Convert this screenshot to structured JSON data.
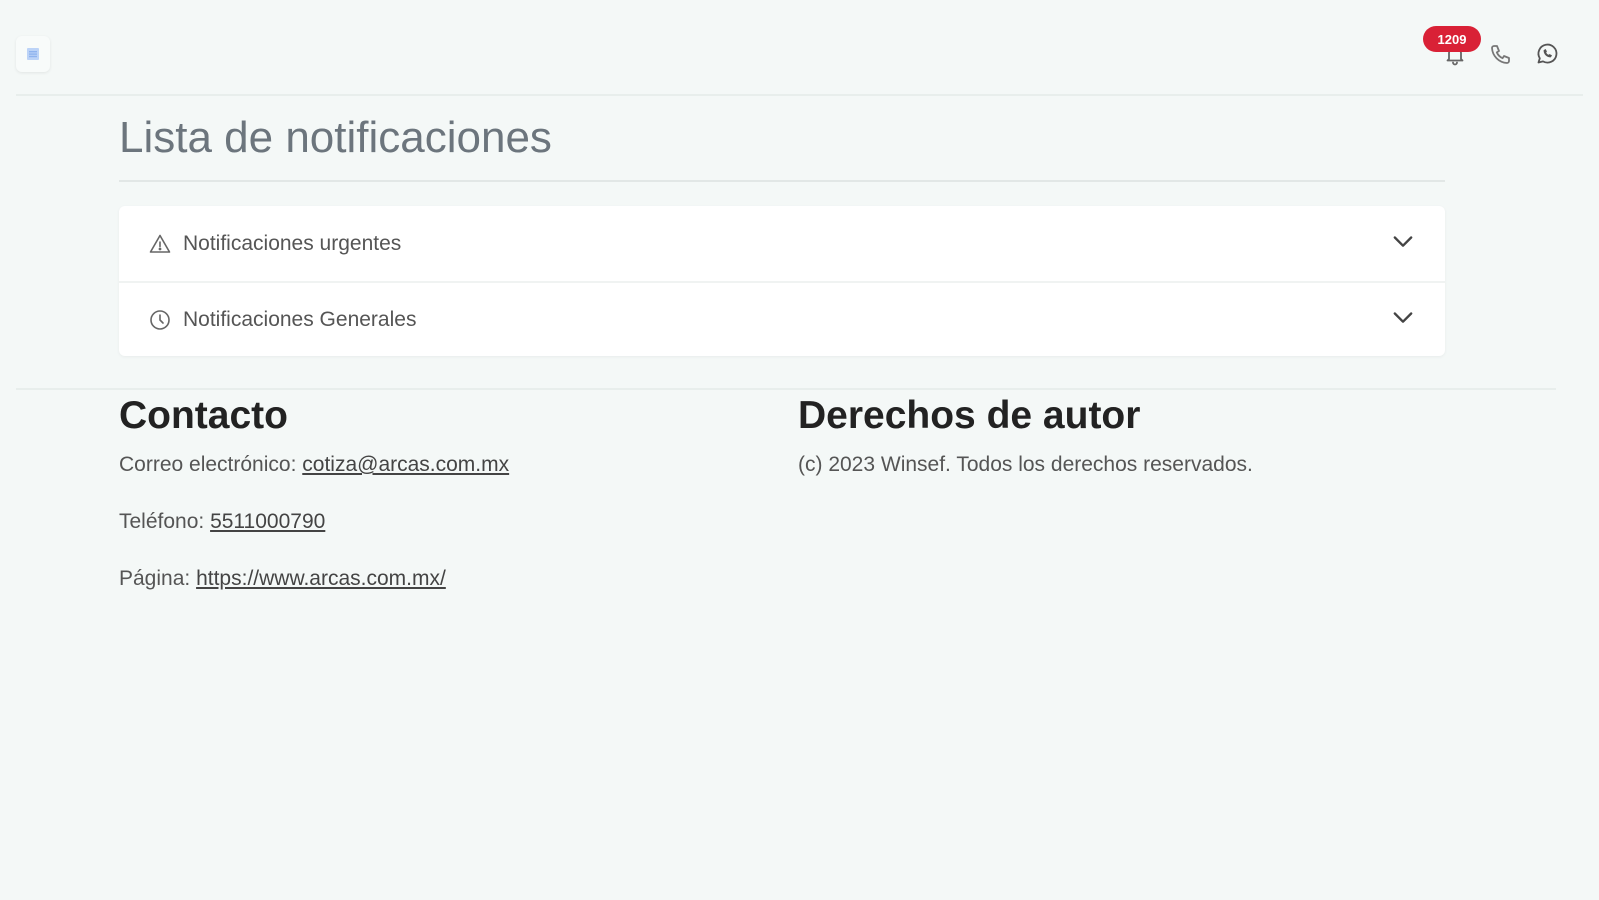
{
  "header": {
    "menu_icon": "menu-icon",
    "notifications": {
      "icon": "bell-icon",
      "count": "1209"
    },
    "phone_icon": "phone-icon",
    "whatsapp_icon": "whatsapp-icon",
    "badge_color": "#d92136"
  },
  "main": {
    "title": "Lista de notificaciones",
    "sections": [
      {
        "icon": "warning-triangle-icon",
        "label": "Notificaciones urgentes"
      },
      {
        "icon": "clock-icon",
        "label": "Notificaciones Generales"
      }
    ]
  },
  "footer": {
    "contact": {
      "heading": "Contacto",
      "email_label": "Correo electrónico:",
      "email": "cotiza@arcas.com.mx",
      "phone_label": "Teléfono:",
      "phone": "5511000790",
      "page_label": "Página:",
      "page": "https://www.arcas.com.mx/"
    },
    "rights": {
      "heading": "Derechos de autor",
      "text": "(c) 2023 Winsef. Todos los derechos reservados."
    }
  }
}
